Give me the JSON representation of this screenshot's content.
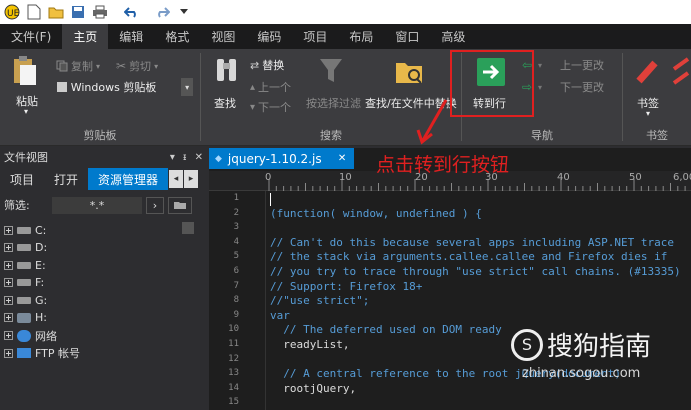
{
  "quick_access": {
    "icons": [
      "app-logo-icon",
      "new-file-icon",
      "open-folder-icon",
      "save-icon",
      "print-icon",
      "undo-icon",
      "redo-icon",
      "dropdown-icon"
    ]
  },
  "menu_tabs": [
    "文件(F)",
    "主页",
    "编辑",
    "格式",
    "视图",
    "编码",
    "项目",
    "布局",
    "窗口",
    "高级"
  ],
  "active_menu_tab": "主页",
  "ribbon": {
    "paste": "粘贴",
    "copy": "复制",
    "cut": "剪切",
    "clipboard_select": "Windows 剪贴板",
    "clipboard_group": "剪贴板",
    "find": "查找",
    "replace": "替换",
    "prev": "上一个",
    "next": "下一个",
    "filter": "按选择过滤",
    "find_in_files": "查找/在文件中替换",
    "search_group": "搜索",
    "goto_line": "转到行",
    "prev_change": "上一更改",
    "next_change": "下一更改",
    "nav_group": "导航",
    "bookmark": "书签",
    "bookmark_group": "书签"
  },
  "left_panel": {
    "title": "文件视图",
    "tabs": [
      "项目",
      "打开",
      "资源管理器"
    ],
    "active_tab": "资源管理器",
    "filter_label": "筛选:",
    "filter_value": "*.*",
    "tree": [
      "C:",
      "D:",
      "E:",
      "F:",
      "G:",
      "H:",
      "网络",
      "FTP 帐号"
    ]
  },
  "editor": {
    "tab_title": "jquery-1.10.2.js",
    "ruler_marks": [
      "0",
      "10",
      "20",
      "30",
      "40",
      "50",
      "6,00"
    ],
    "line_numbers": [
      "1",
      "2",
      "3",
      "4",
      "5",
      "6",
      "7",
      "8",
      "9",
      "10",
      "11",
      "12",
      "13",
      "14",
      "15"
    ],
    "lines": [
      "",
      "(function( window, undefined ) {",
      "",
      "// Can't do this because several apps including ASP.NET trace",
      "// the stack via arguments.callee.callee and Firefox dies if",
      "// you try to trace through \"use strict\" call chains. (#13335)",
      "// Support: Firefox 18+",
      "//\"use strict\";",
      "var",
      "  // The deferred used on DOM ready",
      "  readyList,",
      "",
      "  // A central reference to the root jQuery(document)",
      "  rootjQuery,",
      ""
    ]
  },
  "annotation": "点击转到行按钮",
  "watermark": {
    "brand": "搜狗指南",
    "url": "zhinan.sogou.com"
  }
}
